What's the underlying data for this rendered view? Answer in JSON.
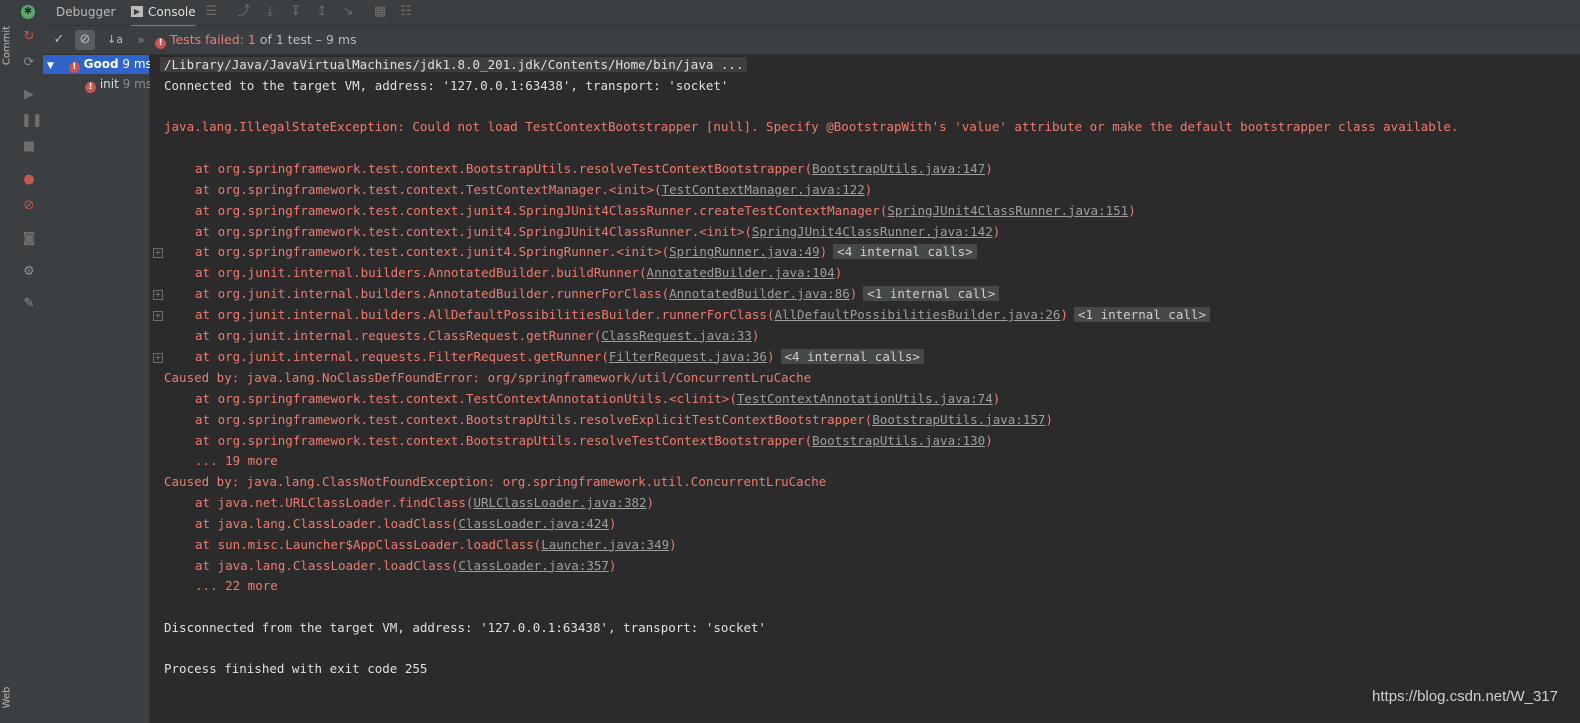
{
  "side_strip": {
    "top_label": "Commit",
    "bottom_label": "Web"
  },
  "tabs": [
    {
      "label": "Debugger"
    },
    {
      "label": "Console"
    }
  ],
  "status": {
    "prefix": "Tests failed:",
    "failed_count": "1",
    "detail": "of 1 test – 9 ms"
  },
  "tree": {
    "root": {
      "label": "Good",
      "time": "9 ms"
    },
    "child": {
      "label": "init",
      "time": "9 ms"
    }
  },
  "console": {
    "cmd": "/Library/Java/JavaVirtualMachines/jdk1.8.0_201.jdk/Contents/Home/bin/java ...",
    "connected": "Connected to the target VM, address: '127.0.0.1:63438', transport: 'socket'",
    "exception": "java.lang.IllegalStateException: Could not load TestContextBootstrapper [null]. Specify @BootstrapWith's 'value' attribute or make the default bootstrapper class available.",
    "frames1": [
      {
        "text": "at org.springframework.test.context.BootstrapUtils.resolveTestContextBootstrapper(",
        "link": "BootstrapUtils.java:147",
        "tail": ")",
        "internal": ""
      },
      {
        "text": "at org.springframework.test.context.TestContextManager.<init>(",
        "link": "TestContextManager.java:122",
        "tail": ")",
        "internal": ""
      },
      {
        "text": "at org.springframework.test.context.junit4.SpringJUnit4ClassRunner.createTestContextManager(",
        "link": "SpringJUnit4ClassRunner.java:151",
        "tail": ")",
        "internal": ""
      },
      {
        "text": "at org.springframework.test.context.junit4.SpringJUnit4ClassRunner.<init>(",
        "link": "SpringJUnit4ClassRunner.java:142",
        "tail": ")",
        "internal": ""
      },
      {
        "text": "at org.springframework.test.context.junit4.SpringRunner.<init>(",
        "link": "SpringRunner.java:49",
        "tail": ")",
        "internal": "<4 internal calls>"
      },
      {
        "text": "at org.junit.internal.builders.AnnotatedBuilder.buildRunner(",
        "link": "AnnotatedBuilder.java:104",
        "tail": ")",
        "internal": ""
      },
      {
        "text": "at org.junit.internal.builders.AnnotatedBuilder.runnerForClass(",
        "link": "AnnotatedBuilder.java:86",
        "tail": ")",
        "internal": "<1 internal call>"
      },
      {
        "text": "at org.junit.internal.builders.AllDefaultPossibilitiesBuilder.runnerForClass(",
        "link": "AllDefaultPossibilitiesBuilder.java:26",
        "tail": ")",
        "internal": "<1 internal call>"
      },
      {
        "text": "at org.junit.internal.requests.ClassRequest.getRunner(",
        "link": "ClassRequest.java:33",
        "tail": ")",
        "internal": ""
      },
      {
        "text": "at org.junit.internal.requests.FilterRequest.getRunner(",
        "link": "FilterRequest.java:36",
        "tail": ")",
        "internal": "<4 internal calls>"
      }
    ],
    "caused1": "Caused by: java.lang.NoClassDefFoundError: org/springframework/util/ConcurrentLruCache",
    "frames2": [
      {
        "text": "at org.springframework.test.context.TestContextAnnotationUtils.<clinit>(",
        "link": "TestContextAnnotationUtils.java:74",
        "tail": ")",
        "internal": ""
      },
      {
        "text": "at org.springframework.test.context.BootstrapUtils.resolveExplicitTestContextBootstrapper(",
        "link": "BootstrapUtils.java:157",
        "tail": ")",
        "internal": ""
      },
      {
        "text": "at org.springframework.test.context.BootstrapUtils.resolveTestContextBootstrapper(",
        "link": "BootstrapUtils.java:130",
        "tail": ")",
        "internal": ""
      }
    ],
    "more1": "... 19 more",
    "caused2": "Caused by: java.lang.ClassNotFoundException: org.springframework.util.ConcurrentLruCache",
    "frames3": [
      {
        "text": "at java.net.URLClassLoader.findClass(",
        "link": "URLClassLoader.java:382",
        "tail": ")",
        "internal": ""
      },
      {
        "text": "at java.lang.ClassLoader.loadClass(",
        "link": "ClassLoader.java:424",
        "tail": ")",
        "internal": ""
      },
      {
        "text": "at sun.misc.Launcher$AppClassLoader.loadClass(",
        "link": "Launcher.java:349",
        "tail": ")",
        "internal": ""
      },
      {
        "text": "at java.lang.ClassLoader.loadClass(",
        "link": "ClassLoader.java:357",
        "tail": ")",
        "internal": ""
      }
    ],
    "more2": "... 22 more",
    "disconnected": "Disconnected from the target VM, address: '127.0.0.1:63438', transport: 'socket'",
    "finished": "Process finished with exit code 255"
  },
  "watermark": "https://blog.csdn.net/W_317",
  "colors": {
    "error": "#ef7b70",
    "fail_badge": "#c75450",
    "selection": "#2f65ca",
    "tab_underline": "#4a88c7"
  }
}
